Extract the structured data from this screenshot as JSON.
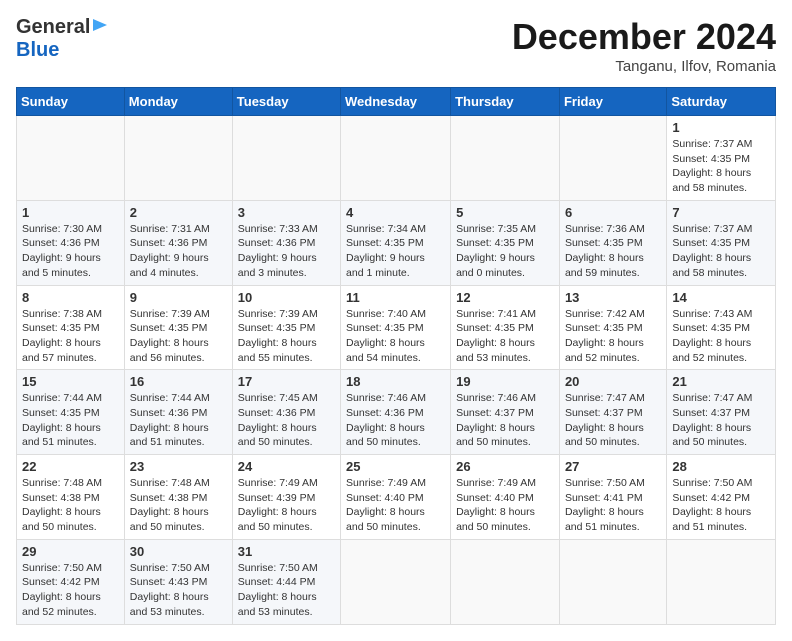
{
  "header": {
    "logo_general": "General",
    "logo_blue": "Blue",
    "month_title": "December 2024",
    "location": "Tanganu, Ilfov, Romania"
  },
  "calendar": {
    "days_of_week": [
      "Sunday",
      "Monday",
      "Tuesday",
      "Wednesday",
      "Thursday",
      "Friday",
      "Saturday"
    ],
    "weeks": [
      [
        {
          "day": "",
          "empty": true
        },
        {
          "day": "",
          "empty": true
        },
        {
          "day": "",
          "empty": true
        },
        {
          "day": "",
          "empty": true
        },
        {
          "day": "",
          "empty": true
        },
        {
          "day": "",
          "empty": true
        },
        {
          "day": "1",
          "sunrise": "Sunrise: 7:37 AM",
          "sunset": "Sunset: 4:35 PM",
          "daylight": "Daylight: 8 hours and 58 minutes."
        }
      ],
      [
        {
          "day": "1",
          "sunrise": "Sunrise: 7:30 AM",
          "sunset": "Sunset: 4:36 PM",
          "daylight": "Daylight: 9 hours and 5 minutes."
        },
        {
          "day": "2",
          "sunrise": "Sunrise: 7:31 AM",
          "sunset": "Sunset: 4:36 PM",
          "daylight": "Daylight: 9 hours and 4 minutes."
        },
        {
          "day": "3",
          "sunrise": "Sunrise: 7:33 AM",
          "sunset": "Sunset: 4:36 PM",
          "daylight": "Daylight: 9 hours and 3 minutes."
        },
        {
          "day": "4",
          "sunrise": "Sunrise: 7:34 AM",
          "sunset": "Sunset: 4:35 PM",
          "daylight": "Daylight: 9 hours and 1 minute."
        },
        {
          "day": "5",
          "sunrise": "Sunrise: 7:35 AM",
          "sunset": "Sunset: 4:35 PM",
          "daylight": "Daylight: 9 hours and 0 minutes."
        },
        {
          "day": "6",
          "sunrise": "Sunrise: 7:36 AM",
          "sunset": "Sunset: 4:35 PM",
          "daylight": "Daylight: 8 hours and 59 minutes."
        },
        {
          "day": "7",
          "sunrise": "Sunrise: 7:37 AM",
          "sunset": "Sunset: 4:35 PM",
          "daylight": "Daylight: 8 hours and 58 minutes."
        }
      ],
      [
        {
          "day": "8",
          "sunrise": "Sunrise: 7:38 AM",
          "sunset": "Sunset: 4:35 PM",
          "daylight": "Daylight: 8 hours and 57 minutes."
        },
        {
          "day": "9",
          "sunrise": "Sunrise: 7:39 AM",
          "sunset": "Sunset: 4:35 PM",
          "daylight": "Daylight: 8 hours and 56 minutes."
        },
        {
          "day": "10",
          "sunrise": "Sunrise: 7:39 AM",
          "sunset": "Sunset: 4:35 PM",
          "daylight": "Daylight: 8 hours and 55 minutes."
        },
        {
          "day": "11",
          "sunrise": "Sunrise: 7:40 AM",
          "sunset": "Sunset: 4:35 PM",
          "daylight": "Daylight: 8 hours and 54 minutes."
        },
        {
          "day": "12",
          "sunrise": "Sunrise: 7:41 AM",
          "sunset": "Sunset: 4:35 PM",
          "daylight": "Daylight: 8 hours and 53 minutes."
        },
        {
          "day": "13",
          "sunrise": "Sunrise: 7:42 AM",
          "sunset": "Sunset: 4:35 PM",
          "daylight": "Daylight: 8 hours and 52 minutes."
        },
        {
          "day": "14",
          "sunrise": "Sunrise: 7:43 AM",
          "sunset": "Sunset: 4:35 PM",
          "daylight": "Daylight: 8 hours and 52 minutes."
        }
      ],
      [
        {
          "day": "15",
          "sunrise": "Sunrise: 7:44 AM",
          "sunset": "Sunset: 4:35 PM",
          "daylight": "Daylight: 8 hours and 51 minutes."
        },
        {
          "day": "16",
          "sunrise": "Sunrise: 7:44 AM",
          "sunset": "Sunset: 4:36 PM",
          "daylight": "Daylight: 8 hours and 51 minutes."
        },
        {
          "day": "17",
          "sunrise": "Sunrise: 7:45 AM",
          "sunset": "Sunset: 4:36 PM",
          "daylight": "Daylight: 8 hours and 50 minutes."
        },
        {
          "day": "18",
          "sunrise": "Sunrise: 7:46 AM",
          "sunset": "Sunset: 4:36 PM",
          "daylight": "Daylight: 8 hours and 50 minutes."
        },
        {
          "day": "19",
          "sunrise": "Sunrise: 7:46 AM",
          "sunset": "Sunset: 4:37 PM",
          "daylight": "Daylight: 8 hours and 50 minutes."
        },
        {
          "day": "20",
          "sunrise": "Sunrise: 7:47 AM",
          "sunset": "Sunset: 4:37 PM",
          "daylight": "Daylight: 8 hours and 50 minutes."
        },
        {
          "day": "21",
          "sunrise": "Sunrise: 7:47 AM",
          "sunset": "Sunset: 4:37 PM",
          "daylight": "Daylight: 8 hours and 50 minutes."
        }
      ],
      [
        {
          "day": "22",
          "sunrise": "Sunrise: 7:48 AM",
          "sunset": "Sunset: 4:38 PM",
          "daylight": "Daylight: 8 hours and 50 minutes."
        },
        {
          "day": "23",
          "sunrise": "Sunrise: 7:48 AM",
          "sunset": "Sunset: 4:38 PM",
          "daylight": "Daylight: 8 hours and 50 minutes."
        },
        {
          "day": "24",
          "sunrise": "Sunrise: 7:49 AM",
          "sunset": "Sunset: 4:39 PM",
          "daylight": "Daylight: 8 hours and 50 minutes."
        },
        {
          "day": "25",
          "sunrise": "Sunrise: 7:49 AM",
          "sunset": "Sunset: 4:40 PM",
          "daylight": "Daylight: 8 hours and 50 minutes."
        },
        {
          "day": "26",
          "sunrise": "Sunrise: 7:49 AM",
          "sunset": "Sunset: 4:40 PM",
          "daylight": "Daylight: 8 hours and 50 minutes."
        },
        {
          "day": "27",
          "sunrise": "Sunrise: 7:50 AM",
          "sunset": "Sunset: 4:41 PM",
          "daylight": "Daylight: 8 hours and 51 minutes."
        },
        {
          "day": "28",
          "sunrise": "Sunrise: 7:50 AM",
          "sunset": "Sunset: 4:42 PM",
          "daylight": "Daylight: 8 hours and 51 minutes."
        }
      ],
      [
        {
          "day": "29",
          "sunrise": "Sunrise: 7:50 AM",
          "sunset": "Sunset: 4:42 PM",
          "daylight": "Daylight: 8 hours and 52 minutes."
        },
        {
          "day": "30",
          "sunrise": "Sunrise: 7:50 AM",
          "sunset": "Sunset: 4:43 PM",
          "daylight": "Daylight: 8 hours and 53 minutes."
        },
        {
          "day": "31",
          "sunrise": "Sunrise: 7:50 AM",
          "sunset": "Sunset: 4:44 PM",
          "daylight": "Daylight: 8 hours and 53 minutes."
        },
        {
          "day": "",
          "empty": true
        },
        {
          "day": "",
          "empty": true
        },
        {
          "day": "",
          "empty": true
        },
        {
          "day": "",
          "empty": true
        }
      ]
    ]
  }
}
